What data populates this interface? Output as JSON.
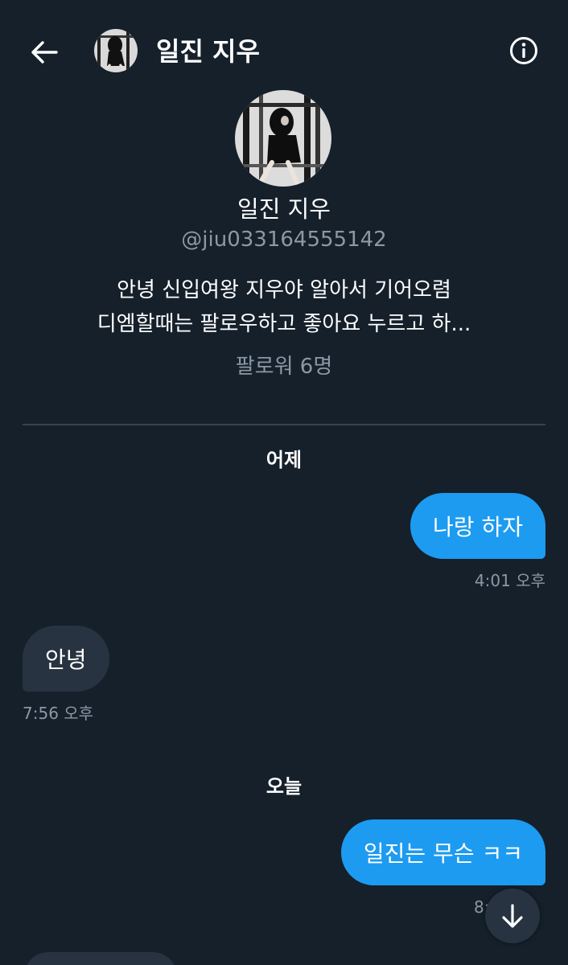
{
  "header": {
    "name": "일진 지우"
  },
  "profile": {
    "name": "일진 지우",
    "handle": "@jiu033164555142",
    "bio_line1": "안녕 신입여왕 지우야 알아서 기어오렴",
    "bio_line2": "디엠할때는 팔로우하고 좋아요 누르고 하...",
    "followers": "팔로워 6명"
  },
  "conversation": {
    "date_yesterday": "어제",
    "date_today": "오늘",
    "messages": [
      {
        "direction": "sent",
        "text": "나랑 하자",
        "time": "4:01 오후"
      },
      {
        "direction": "received",
        "text": "안녕",
        "time": "7:56 오후"
      },
      {
        "direction": "sent",
        "text": "일진는 무슨 ㅋㅋ",
        "time": "8:"
      }
    ]
  },
  "colors": {
    "background": "#15202b",
    "sent_bubble": "#1d9bf0",
    "received_bubble": "#273340",
    "secondary_text": "#8b98a5"
  },
  "icons": {
    "back": "arrow-left-icon",
    "info": "info-circle-icon",
    "scroll_down": "arrow-down-icon"
  }
}
